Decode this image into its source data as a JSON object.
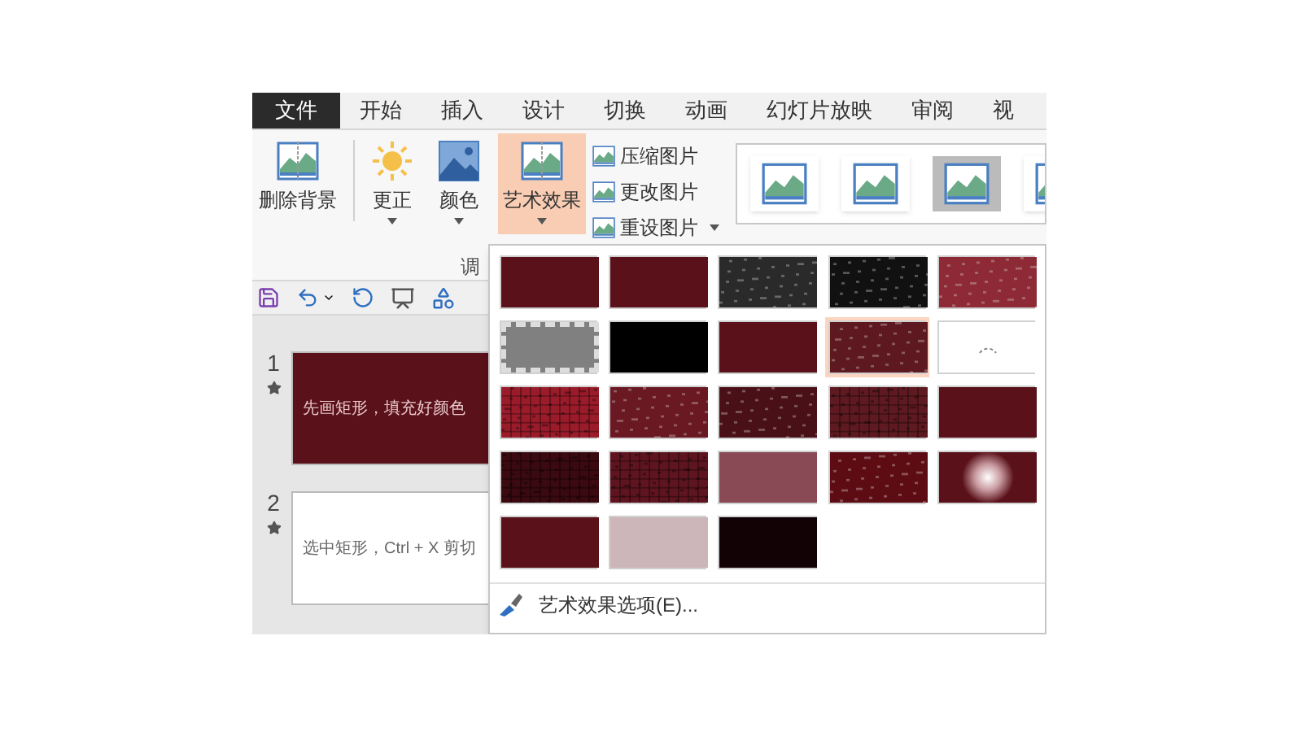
{
  "tabs": [
    {
      "label": "文件",
      "selected": false,
      "kind": "file"
    },
    {
      "label": "开始",
      "selected": false,
      "kind": "tab"
    },
    {
      "label": "插入",
      "selected": false,
      "kind": "tab"
    },
    {
      "label": "设计",
      "selected": false,
      "kind": "tab"
    },
    {
      "label": "切换",
      "selected": false,
      "kind": "tab"
    },
    {
      "label": "动画",
      "selected": false,
      "kind": "tab"
    },
    {
      "label": "幻灯片放映",
      "selected": false,
      "kind": "tab"
    },
    {
      "label": "审阅",
      "selected": false,
      "kind": "tab"
    },
    {
      "label": "视",
      "selected": false,
      "kind": "tab"
    }
  ],
  "ribbon": {
    "remove_background": "删除背景",
    "corrections": "更正",
    "color_label": "颜色",
    "artistic_effects": {
      "label": "艺术效果",
      "pressed": true
    },
    "small_buttons": [
      "压缩图片",
      "更改图片",
      "重设图片"
    ],
    "group_label": "调"
  },
  "slides": [
    {
      "number": "1",
      "text": "先画矩形，填充好颜色",
      "color": "#5a1119"
    },
    {
      "number": "2",
      "text": "选中矩形，Ctrl + X 剪切",
      "color": "#ffffff"
    }
  ],
  "effects_menu": {
    "tiles": [
      {
        "kind": "plain",
        "color": "#5a1119",
        "selected": false
      },
      {
        "kind": "plain",
        "color": "#5a1119",
        "selected": false
      },
      {
        "kind": "texture",
        "color": "#2a2a2a",
        "selected": false
      },
      {
        "kind": "texture",
        "color": "#111111",
        "selected": false
      },
      {
        "kind": "texture",
        "color": "#8e2a36",
        "selected": false
      },
      {
        "kind": "frame",
        "color": "#808080",
        "selected": false
      },
      {
        "kind": "plain",
        "color": "#000000",
        "selected": false
      },
      {
        "kind": "plain",
        "color": "#5a1119",
        "selected": false
      },
      {
        "kind": "texture",
        "color": "#5e1820",
        "selected": true
      },
      {
        "kind": "loading",
        "color": "#ffffff",
        "selected": false
      },
      {
        "kind": "grid",
        "color": "#9a1c2a",
        "selected": false
      },
      {
        "kind": "texture",
        "color": "#6a1822",
        "selected": false
      },
      {
        "kind": "texture",
        "color": "#4a1018",
        "selected": false
      },
      {
        "kind": "grid",
        "color": "#5e1a20",
        "selected": false
      },
      {
        "kind": "plain",
        "color": "#5a1119",
        "selected": false
      },
      {
        "kind": "grid",
        "color": "#3a0a10",
        "selected": false
      },
      {
        "kind": "grid",
        "color": "#5e1520",
        "selected": false
      },
      {
        "kind": "plain",
        "color": "#8a4a55",
        "selected": false
      },
      {
        "kind": "texture",
        "color": "#5e0c14",
        "selected": false
      },
      {
        "kind": "glow",
        "color": "#5a1119",
        "selected": false
      },
      {
        "kind": "plain",
        "color": "#5a1119",
        "selected": false
      },
      {
        "kind": "plain",
        "color": "#cdb6b9",
        "selected": false
      },
      {
        "kind": "plain",
        "color": "#120205",
        "selected": false
      }
    ],
    "options": "艺术效果选项(E)..."
  }
}
